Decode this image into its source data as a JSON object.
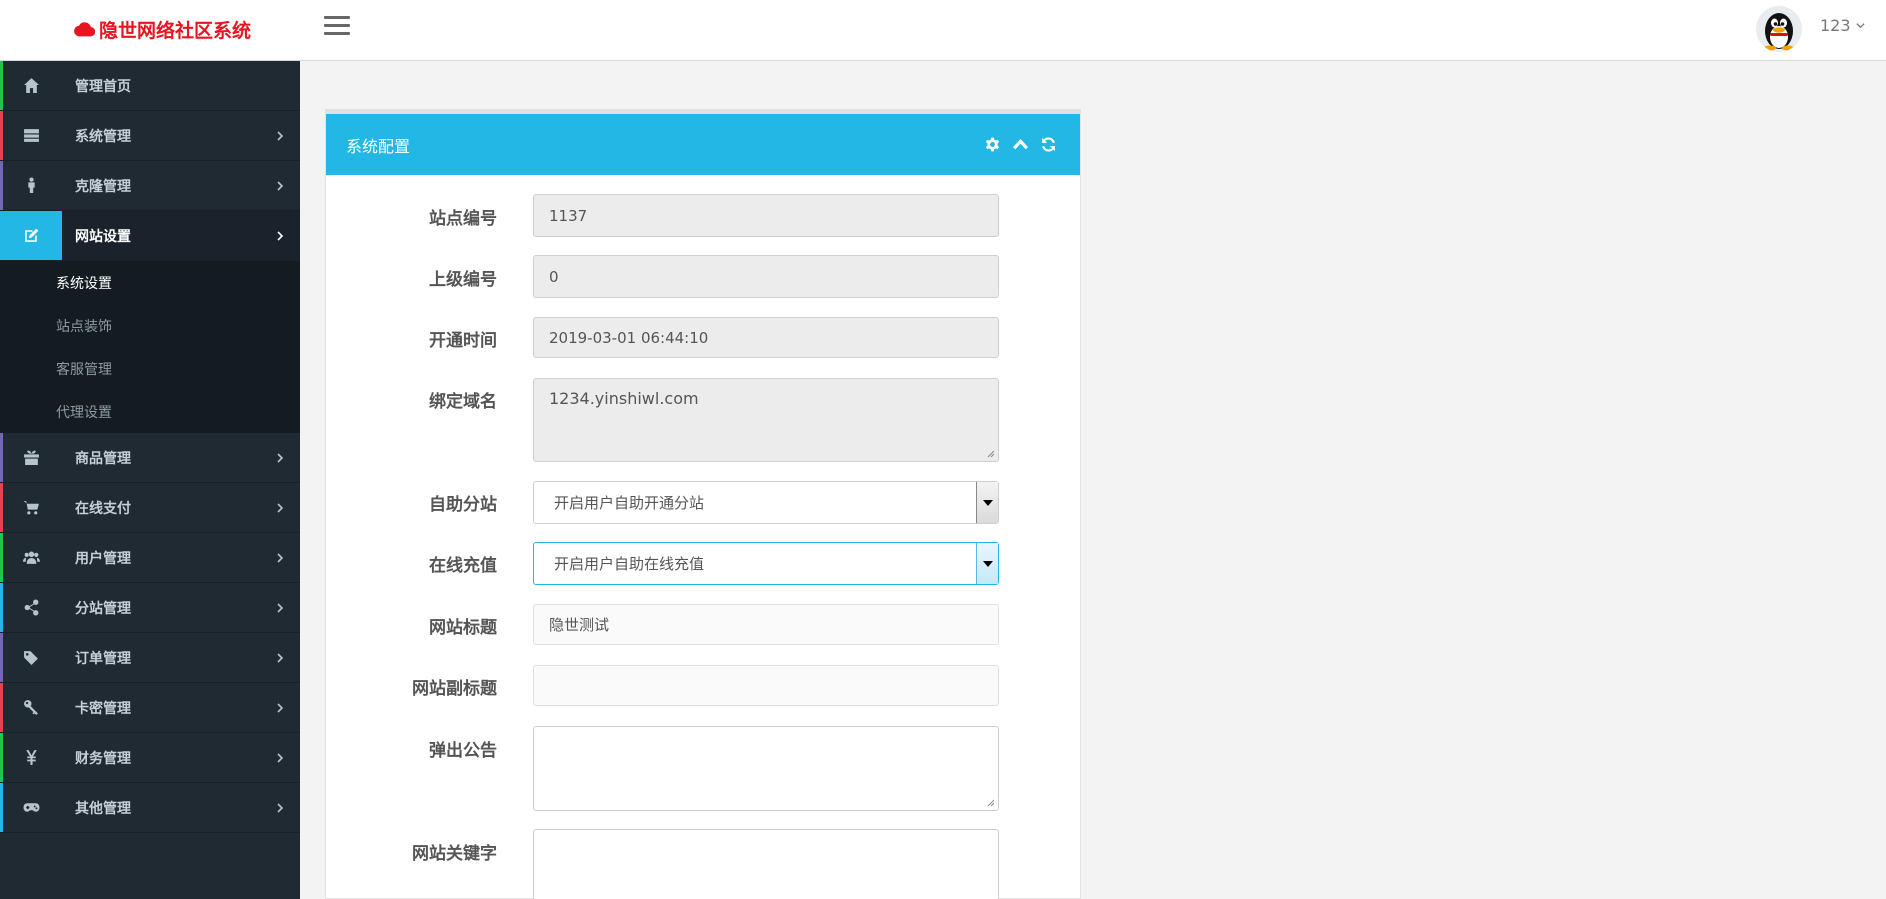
{
  "header": {
    "brand": "隐世网络社区系统",
    "brand_color": "#e8141f",
    "user": "123"
  },
  "sidebar": {
    "items": [
      {
        "label": "管理首页",
        "icon": "home-icon",
        "accent": "#27c24c"
      },
      {
        "label": "系统管理",
        "icon": "server-icon",
        "accent": "#e8424e"
      },
      {
        "label": "克隆管理",
        "icon": "male-icon",
        "accent": "#7266ba"
      },
      {
        "label": "网站设置",
        "icon": "edit-icon",
        "accent": "#23b7e5",
        "active": true
      },
      {
        "label": "商品管理",
        "icon": "gift-icon",
        "accent": "#7266ba"
      },
      {
        "label": "在线支付",
        "icon": "cart-icon",
        "accent": "#e8424e"
      },
      {
        "label": "用户管理",
        "icon": "users-icon",
        "accent": "#27c24c"
      },
      {
        "label": "分站管理",
        "icon": "share-icon",
        "accent": "#23b7e5"
      },
      {
        "label": "订单管理",
        "icon": "tags-icon",
        "accent": "#7266ba"
      },
      {
        "label": "卡密管理",
        "icon": "key-icon",
        "accent": "#e8424e"
      },
      {
        "label": "财务管理",
        "icon": "yen-icon",
        "accent": "#27c24c"
      },
      {
        "label": "其他管理",
        "icon": "gamepad-icon",
        "accent": "#23b7e5"
      }
    ],
    "submenu": [
      "系统设置",
      "站点装饰",
      "客服管理",
      "代理设置"
    ],
    "submenu_active": "系统设置"
  },
  "panel": {
    "title": "系统配置",
    "heading_color": "#23b7e5",
    "tools": [
      "gear-icon",
      "chevron-up-icon",
      "refresh-icon"
    ]
  },
  "form": {
    "site_id_label": "站点编号",
    "site_id": "1137",
    "parent_id_label": "上级编号",
    "parent_id": "0",
    "open_time_label": "开通时间",
    "open_time": "2019-03-01 06:44:10",
    "domain_label": "绑定域名",
    "domain": "1234.yinshiwl.com",
    "self_substation_label": "自助分站",
    "self_substation": "开启用户自助开通分站",
    "online_recharge_label": "在线充值",
    "online_recharge": "开启用户自助在线充值",
    "site_title_label": "网站标题",
    "site_title": "隐世测试",
    "site_subtitle_label": "网站副标题",
    "site_subtitle": "",
    "popup_notice_label": "弹出公告",
    "popup_notice": "",
    "keywords_label": "网站关键字",
    "keywords": ""
  }
}
